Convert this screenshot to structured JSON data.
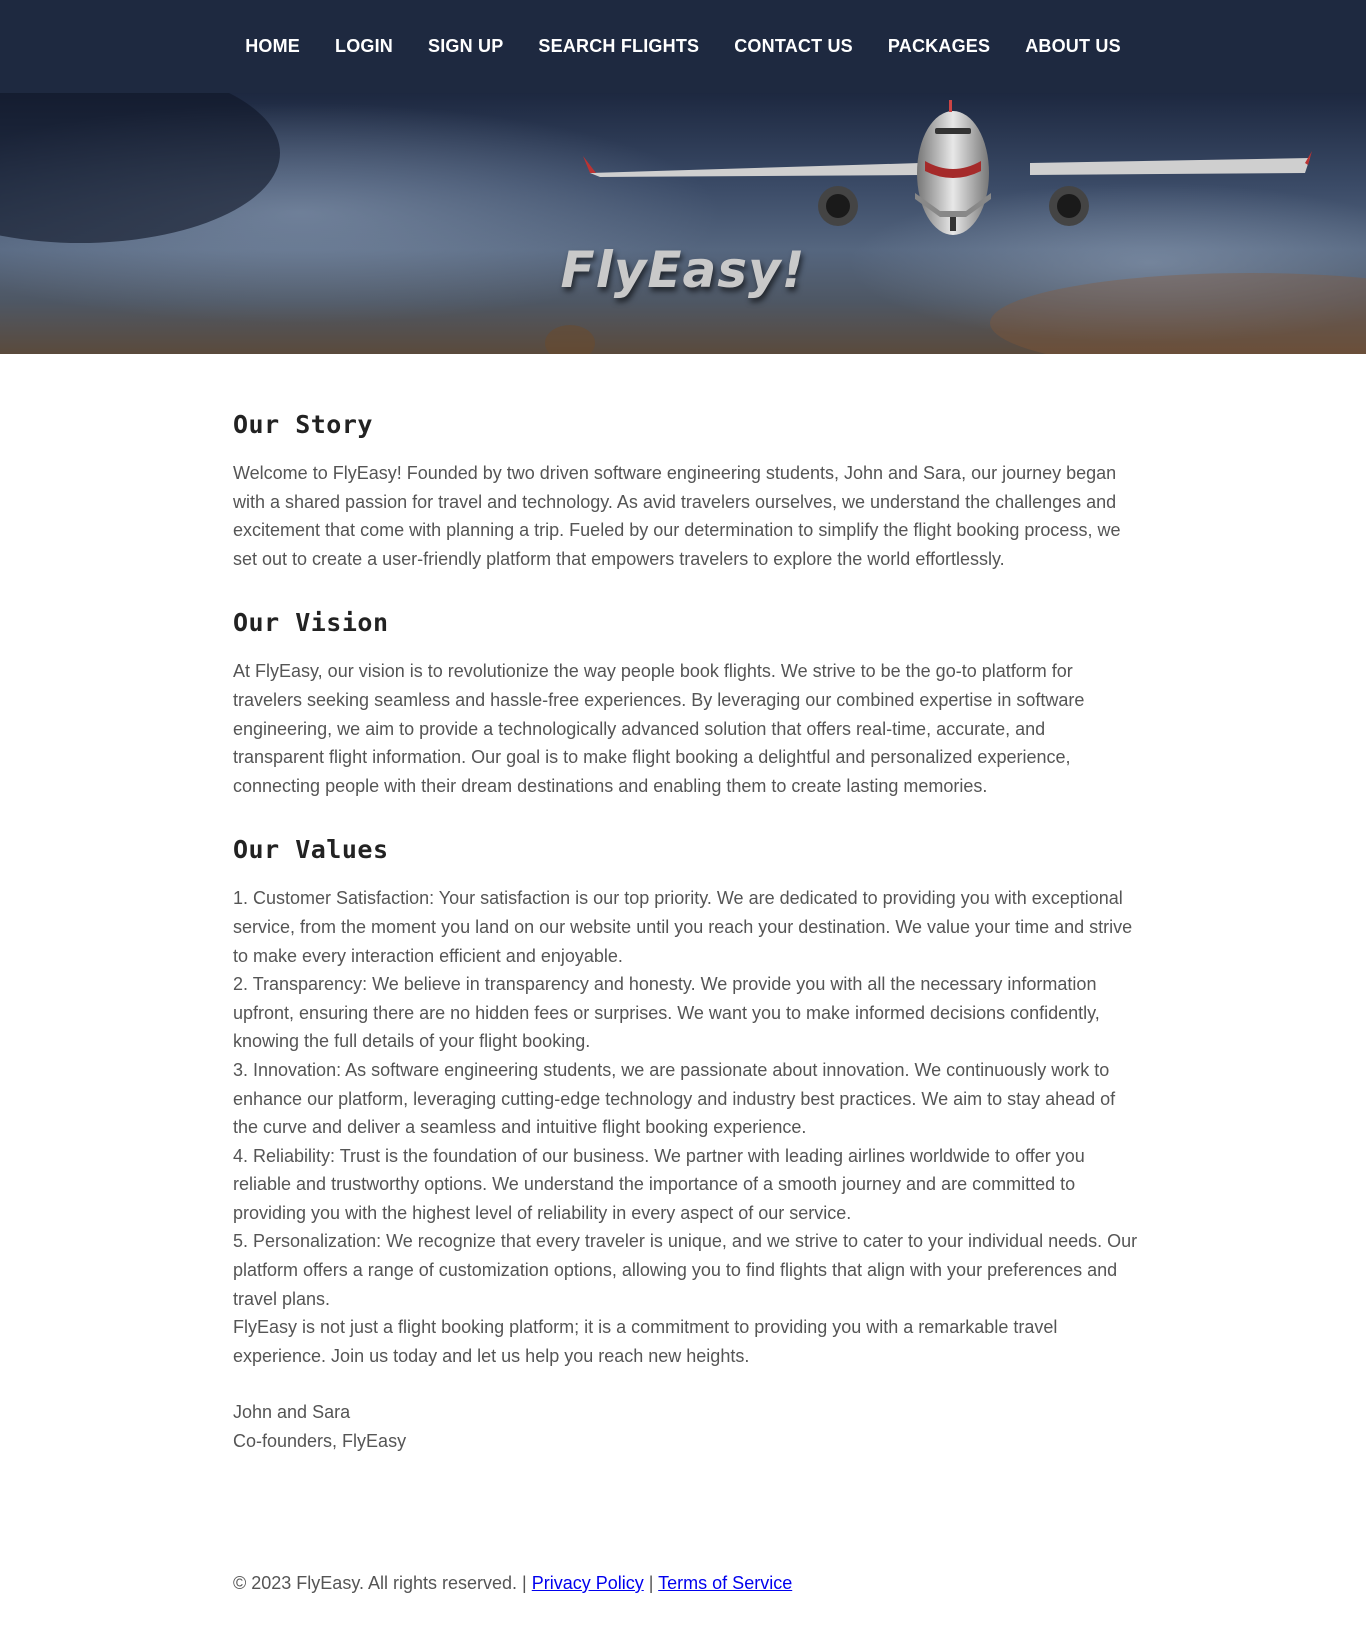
{
  "nav": {
    "items": [
      {
        "label": "HOME"
      },
      {
        "label": "LOGIN"
      },
      {
        "label": "SIGN UP"
      },
      {
        "label": "SEARCH FLIGHTS"
      },
      {
        "label": "CONTACT US"
      },
      {
        "label": "PACKAGES"
      },
      {
        "label": "ABOUT US"
      }
    ],
    "background": "#1e2940",
    "text_color": "#ffffff"
  },
  "hero": {
    "title": "FlyEasy!",
    "image": "airplane-in-flight"
  },
  "story": {
    "heading": "Our Story",
    "text": "Welcome to FlyEasy! Founded by two driven software engineering students, John and Sara, our journey began with a shared passion for travel and technology. As avid travelers ourselves, we understand the challenges and excitement that come with planning a trip. Fueled by our determination to simplify the flight booking process, we set out to create a user-friendly platform that empowers travelers to explore the world effortlessly."
  },
  "vision": {
    "heading": "Our Vision",
    "text": "At FlyEasy, our vision is to revolutionize the way people book flights. We strive to be the go-to platform for travelers seeking seamless and hassle-free experiences. By leveraging our combined expertise in software engineering, we aim to provide a technologically advanced solution that offers real-time, accurate, and transparent flight information. Our goal is to make flight booking a delightful and personalized experience, connecting people with their dream destinations and enabling them to create lasting memories."
  },
  "values": {
    "heading": "Our Values",
    "items": [
      "1. Customer Satisfaction: Your satisfaction is our top priority. We are dedicated to providing you with exceptional service, from the moment you land on our website until you reach your destination. We value your time and strive to make every interaction efficient and enjoyable.",
      "2. Transparency: We believe in transparency and honesty. We provide you with all the necessary information upfront, ensuring there are no hidden fees or surprises. We want you to make informed decisions confidently, knowing the full details of your flight booking.",
      "3. Innovation: As software engineering students, we are passionate about innovation. We continuously work to enhance our platform, leveraging cutting-edge technology and industry best practices. We aim to stay ahead of the curve and deliver a seamless and intuitive flight booking experience.",
      "4. Reliability: Trust is the foundation of our business. We partner with leading airlines worldwide to offer you reliable and trustworthy options. We understand the importance of a smooth journey and are committed to providing you with the highest level of reliability in every aspect of our service.",
      "5. Personalization: We recognize that every traveler is unique, and we strive to cater to your individual needs. Our platform offers a range of customization options, allowing you to find flights that align with your preferences and travel plans."
    ],
    "closing": "FlyEasy is not just a flight booking platform; it is a commitment to providing you with a remarkable travel experience. Join us today and let us help you reach new heights."
  },
  "signoff": {
    "names": "John and Sara",
    "role": "Co-founders, FlyEasy"
  },
  "footer": {
    "copyright": "© 2023 FlyEasy. All rights reserved. |",
    "separator": "|",
    "privacy": "Privacy Policy",
    "terms": "Terms of Service",
    "link_color": "#0000ee"
  }
}
